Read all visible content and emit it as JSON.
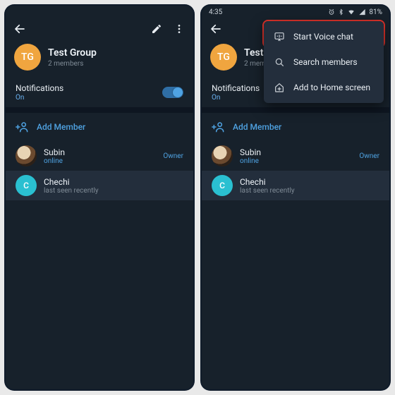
{
  "left": {
    "group": {
      "initials": "TG",
      "title": "Test Group",
      "subtitle": "2 members",
      "avatar_color": "#f0a53f"
    },
    "notifications": {
      "label": "Notifications",
      "value": "On"
    },
    "add_member": "Add Member",
    "members": [
      {
        "name": "Subin",
        "status": "online",
        "status_kind": "online",
        "role": "Owner",
        "avatar_kind": "img"
      },
      {
        "name": "Chechi",
        "status": "last seen recently",
        "status_kind": "dim",
        "initial": "C",
        "avatar_color": "#2ac0d1"
      }
    ]
  },
  "right": {
    "status": {
      "time": "4:35",
      "battery": "81%"
    },
    "group": {
      "initials": "TG",
      "title": "Test Group",
      "subtitle": "2 members",
      "avatar_color": "#f0a53f"
    },
    "notifications": {
      "label": "Notifications",
      "value": "On"
    },
    "add_member": "Add Member",
    "members": [
      {
        "name": "Subin",
        "status": "online",
        "status_kind": "online",
        "role": "Owner",
        "avatar_kind": "img"
      },
      {
        "name": "Chechi",
        "status": "last seen recently",
        "status_kind": "dim",
        "initial": "C",
        "avatar_color": "#2ac0d1"
      }
    ],
    "menu": [
      {
        "key": "voice",
        "label": "Start Voice chat"
      },
      {
        "key": "search",
        "label": "Search members"
      },
      {
        "key": "home",
        "label": "Add to Home screen"
      }
    ]
  }
}
